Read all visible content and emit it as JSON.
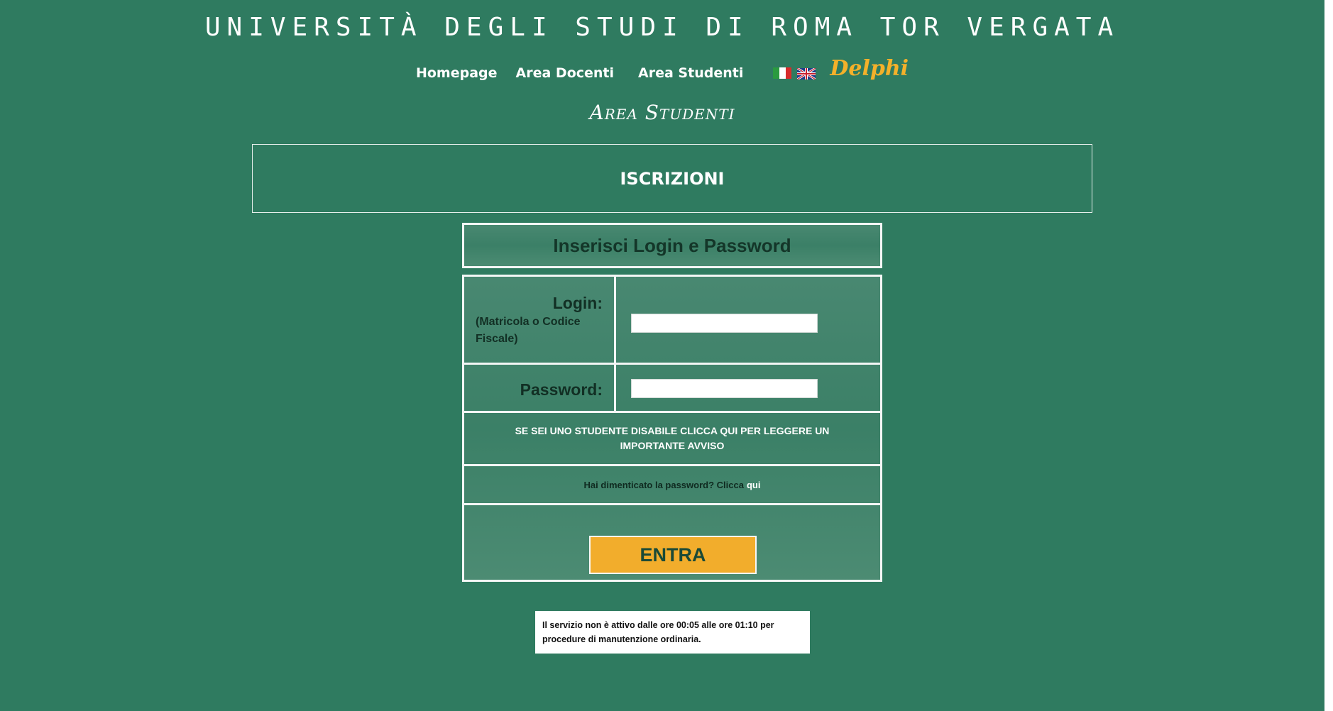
{
  "header": {
    "university_title": "UNIVERSITÀ DEGLI STUDI DI ROMA TOR VERGATA",
    "nav": {
      "homepage": "Homepage",
      "area_docenti": "Area Docenti",
      "area_studenti": "Area Studenti",
      "delphi": "Delphi"
    },
    "flags": [
      "italian-flag-icon",
      "english-flag-icon"
    ]
  },
  "section_heading": "Area Studenti",
  "banner_title": "ISCRIZIONI",
  "login": {
    "heading": "Inserisci Login e Password",
    "login_label": "Login:",
    "login_hint": "(Matricola o Codice Fiscale)",
    "login_value": "",
    "password_label": "Password:",
    "password_value": "",
    "disabled_notice": "SE SEI UNO STUDENTE DISABILE CLICCA QUI PER LEGGERE UN IMPORTANTE AVVISO",
    "forgot_text": "Hai dimenticato la password? Clicca",
    "forgot_link": "qui",
    "submit_label": "ENTRA"
  },
  "maintenance_notice": "Il servizio non è attivo dalle ore 00:05 alle ore 01:10 per procedure di manutenzione ordinaria.",
  "colors": {
    "background": "#2f7b60",
    "button": "#f2ad2c",
    "delphi": "#f4b12a"
  }
}
